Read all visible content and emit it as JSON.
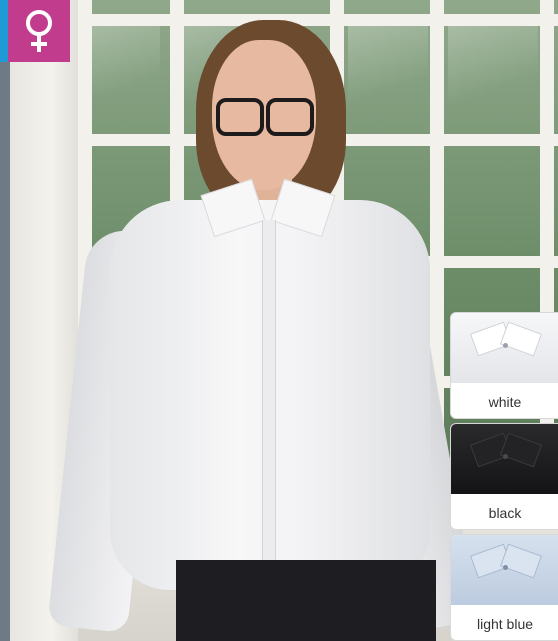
{
  "badge": {
    "icon": "female-symbol-icon",
    "background_color": "#c23c8d",
    "accent_color": "#1f9ad6"
  },
  "photo": {
    "subject": "woman-wearing-long-sleeve-shirt"
  },
  "color_options": [
    {
      "label": "white",
      "swatch_color": "#f2f3f5"
    },
    {
      "label": "black",
      "swatch_color": "#1c1c1e"
    },
    {
      "label": "light blue",
      "swatch_color": "#c9d7e8"
    }
  ]
}
